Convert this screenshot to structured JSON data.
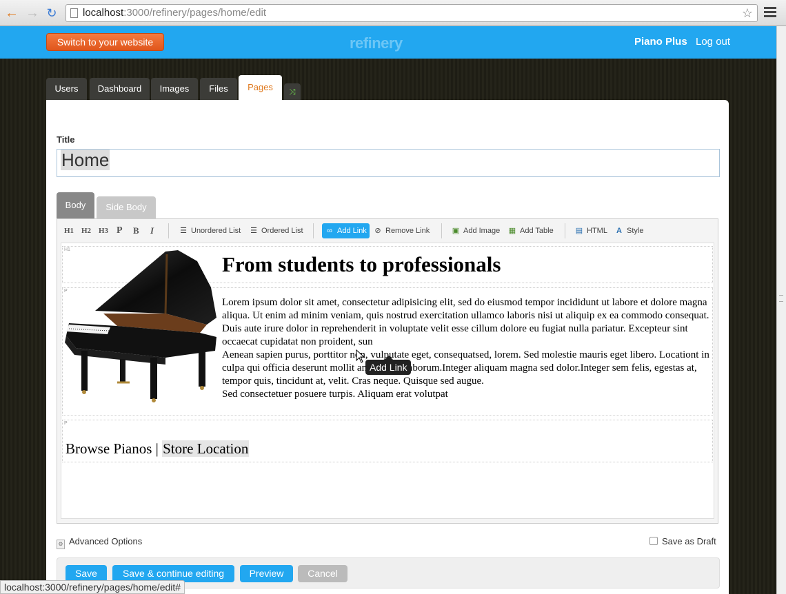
{
  "browser": {
    "url_host": "localhost",
    "url_path": ":3000/refinery/pages/home/edit",
    "status_url": "localhost:3000/refinery/pages/home/edit#"
  },
  "header": {
    "switch_label": "Switch to your website",
    "logo": "refinery",
    "site_name": "Piano Plus",
    "logout": "Log out"
  },
  "tabs": [
    {
      "label": "Users"
    },
    {
      "label": "Dashboard"
    },
    {
      "label": "Images"
    },
    {
      "label": "Files"
    },
    {
      "label": "Pages",
      "active": true
    }
  ],
  "form": {
    "title_label": "Title",
    "title_value": "Home",
    "body_tab": "Body",
    "side_body_tab": "Side Body"
  },
  "toolbar": {
    "h1": "H1",
    "h2": "H2",
    "h3": "H3",
    "p": "P",
    "b": "B",
    "i": "I",
    "unordered": "Unordered List",
    "ordered": "Ordered List",
    "add_link": "Add Link",
    "remove_link": "Remove Link",
    "add_image": "Add Image",
    "add_table": "Add Table",
    "html": "HTML",
    "style": "Style"
  },
  "content": {
    "tag_h1": "H1",
    "tag_p": "P",
    "heading": "From students to professionals",
    "para1": "Lorem ipsum dolor sit amet, consectetur adipisicing elit, sed do eiusmod tempor incididunt ut labore et dolore magna aliqua. Ut enim ad minim veniam, quis nostrud exercitation ullamco laboris nisi ut aliquip ex ea commodo consequat.",
    "para2": "Duis aute irure dolor in reprehenderit in voluptate velit esse cillum dolore eu fugiat nulla pariatur. Excepteur sint occaecat cupidatat non proident, sun",
    "para3": "Aenean sapien purus, porttitor non, vulputate eget, consequatsed, lorem. Sed molestie mauris eget libero. Locationt in culpa qui officia deserunt mollit anim id est laborum.Integer aliquam magna sed dolor.Integer sem felis, egestas at, tempor quis, tincidunt at, velit. Cras neque. Quisque sed augue.",
    "para4": "Sed consectetuer posuere turpis. Aliquam erat volutpat",
    "link1": "Browse Pianos",
    "link_sep": " | ",
    "link2": "Store Location"
  },
  "tooltip": "Add Link",
  "options": {
    "advanced": "Advanced Options",
    "draft": "Save as Draft"
  },
  "actions": {
    "save": "Save",
    "save_continue": "Save & continue editing",
    "preview": "Preview",
    "cancel": "Cancel"
  },
  "colors": {
    "accent": "#22a7f0",
    "switch_button": "#e8632a",
    "active_tab_text": "#e07a1f"
  }
}
